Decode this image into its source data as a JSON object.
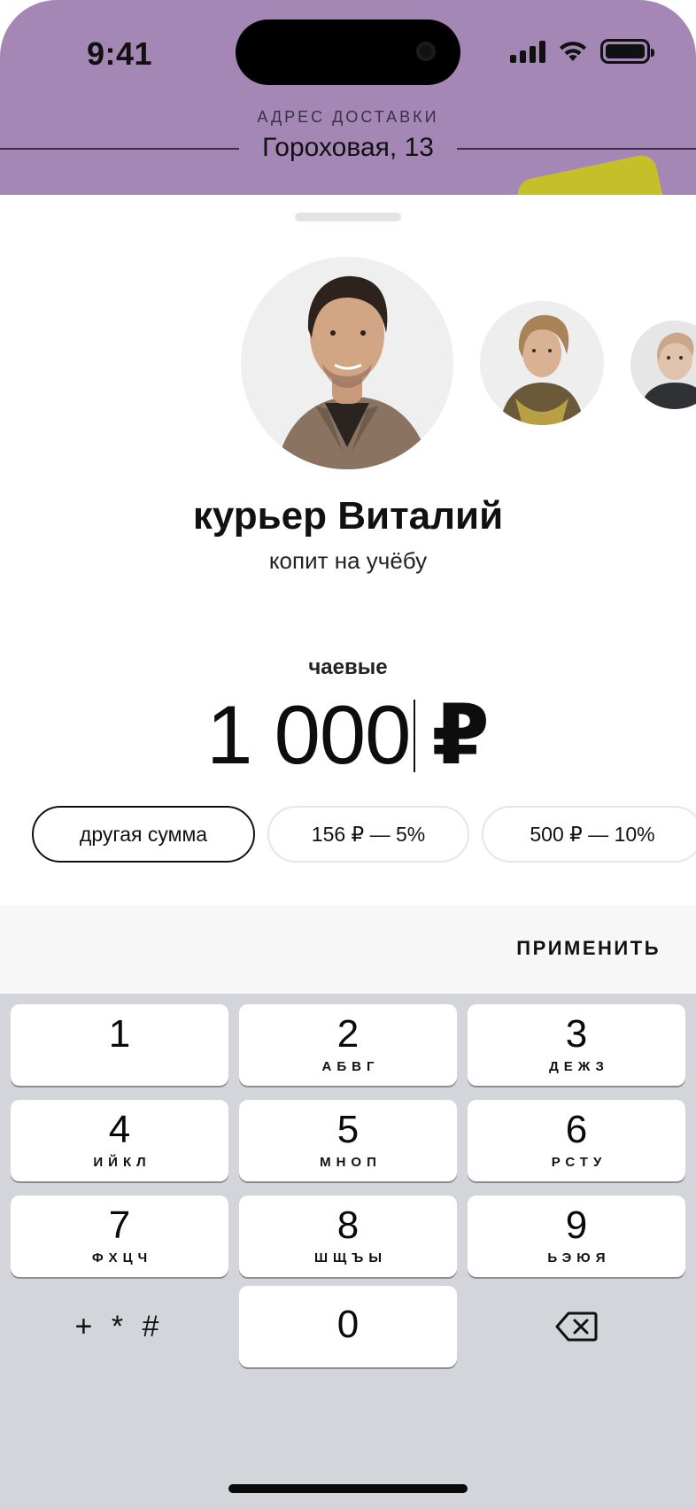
{
  "status_bar": {
    "time": "9:41"
  },
  "header": {
    "address_label": "АДРЕС ДОСТАВКИ",
    "address_value": "Гороховая, 13"
  },
  "courier": {
    "name": "курьер Виталий",
    "note": "копит на учёбу"
  },
  "tips": {
    "label": "чаевые",
    "amount": "1 000",
    "currency": "₽",
    "options": [
      {
        "label": "другая сумма",
        "selected": true
      },
      {
        "label": "156 ₽  —  5%",
        "selected": false
      },
      {
        "label": "500 ₽  —  10%",
        "selected": false
      }
    ],
    "apply_label": "ПРИМЕНИТЬ"
  },
  "keyboard": {
    "keys": [
      {
        "num": "1",
        "letters": ""
      },
      {
        "num": "2",
        "letters": "АБВГ"
      },
      {
        "num": "3",
        "letters": "ДЕЖЗ"
      },
      {
        "num": "4",
        "letters": "ИЙКЛ"
      },
      {
        "num": "5",
        "letters": "МНОП"
      },
      {
        "num": "6",
        "letters": "РСТУ"
      },
      {
        "num": "7",
        "letters": "ФХЦЧ"
      },
      {
        "num": "8",
        "letters": "ШЩЪЫ"
      },
      {
        "num": "9",
        "letters": "ЬЭЮЯ"
      },
      {
        "num": "0",
        "letters": ""
      }
    ],
    "symbols": "+ * #"
  },
  "colors": {
    "header_bg": "#a487b4",
    "keyboard_bg": "#d3d5db",
    "promo_card": "#c5c02a"
  }
}
